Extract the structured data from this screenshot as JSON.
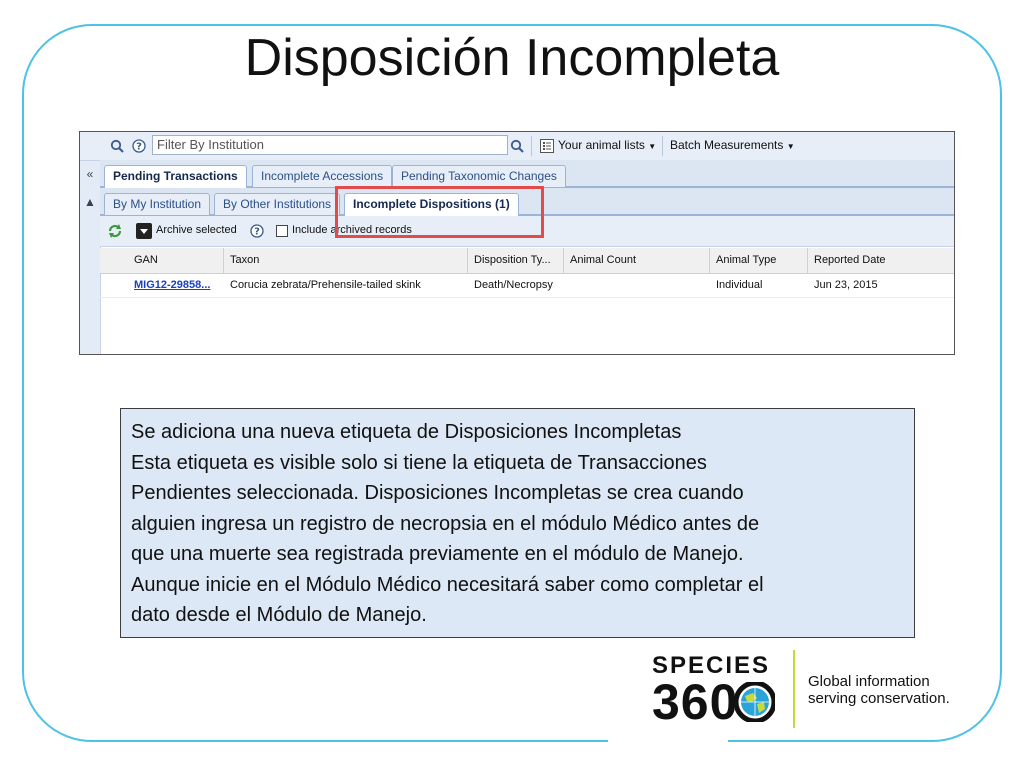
{
  "slide": {
    "title": "Disposición Incompleta",
    "frame_color": "#4dc1e6"
  },
  "app": {
    "toolbar": {
      "filter_placeholder": "Filter By Institution",
      "your_animal_lists": "Your animal lists",
      "batch_measurements": "Batch Measurements"
    },
    "tabs_primary": [
      {
        "label": "Pending Transactions",
        "active": true
      },
      {
        "label": "Incomplete Accessions",
        "active": false
      },
      {
        "label": "Pending Taxonomic Changes",
        "active": false
      }
    ],
    "tabs_secondary": [
      {
        "label": "By My Institution",
        "active": false
      },
      {
        "label": "By Other Institutions",
        "active": false
      },
      {
        "label": "Incomplete Dispositions (1)",
        "active": true
      }
    ],
    "actions": {
      "archive_selected": "Archive selected",
      "include_archived": "Include archived records"
    },
    "grid": {
      "columns": [
        "GAN",
        "Taxon",
        "Disposition Ty...",
        "Animal Count",
        "Animal Type",
        "Reported Date"
      ],
      "rows": [
        {
          "gan": "MIG12-29858...",
          "taxon": "Corucia zebrata/Prehensile-tailed skink",
          "disposition_type": "Death/Necropsy",
          "animal_count": "",
          "animal_type": "Individual",
          "reported_date": "Jun 23, 2015"
        }
      ]
    },
    "highlight_color": "#e14b4b"
  },
  "note": {
    "lines": [
      "Se adiciona una nueva etiqueta de Disposiciones Incompletas",
      "Esta etiqueta es visible solo si tiene la etiqueta de Transacciones",
      "Pendientes seleccionada. Disposiciones Incompletas se crea cuando",
      "alguien ingresa un registro de necropsia en el módulo Médico antes de",
      "que una muerte sea registrada previamente en el módulo de Manejo.",
      "Aunque inicie en el Módulo Médico necesitará saber como completar el",
      "dato desde el Módulo de Manejo."
    ],
    "background": "#dde8f6"
  },
  "logo": {
    "word_top": "SPECIES",
    "word_bottom": "360",
    "tagline_1": "Global information",
    "tagline_2": "serving conservation.",
    "accent_color": "#c7da3b"
  }
}
